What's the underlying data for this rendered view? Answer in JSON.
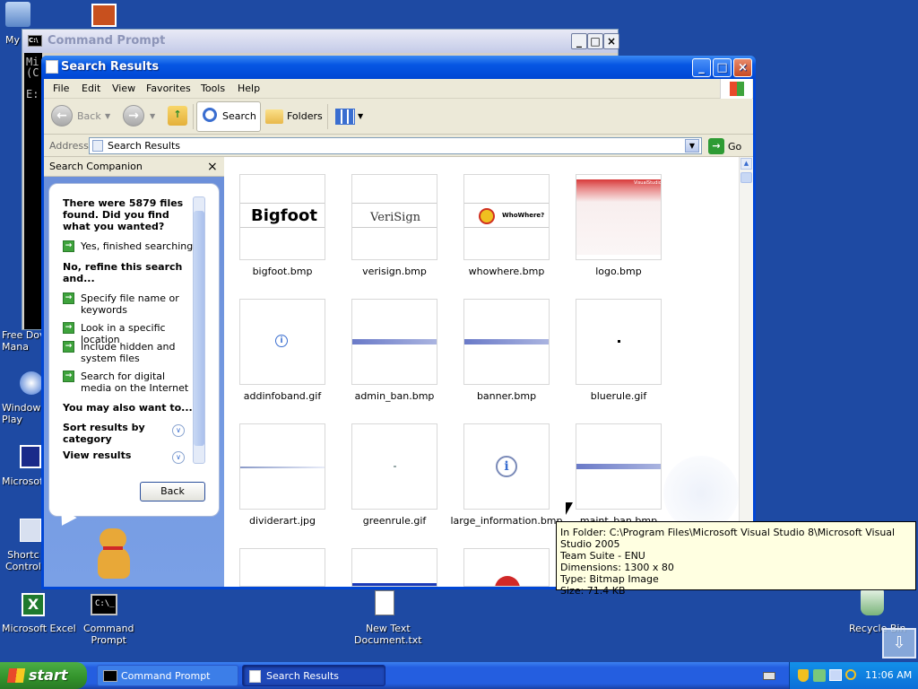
{
  "desktop": {
    "icons": [
      {
        "label": "My"
      },
      {
        "label": "Free Dov\nMana"
      },
      {
        "label": "Windows\nPlay"
      },
      {
        "label": "Microsoft"
      },
      {
        "label": "Shortc\nControl"
      },
      {
        "label": "Microsoft Excel"
      },
      {
        "label": "Command\nPrompt"
      },
      {
        "label": "New Text\nDocument.txt"
      },
      {
        "label": "Recycle Bin"
      }
    ]
  },
  "cmd": {
    "title": "Command Prompt",
    "lines": "Mi\n(C\n\nE:"
  },
  "win": {
    "title": "Search Results",
    "menu": [
      "File",
      "Edit",
      "View",
      "Favorites",
      "Tools",
      "Help"
    ],
    "toolbar": {
      "back": "Back",
      "search": "Search",
      "folders": "Folders"
    },
    "address_label": "Address",
    "address_value": "Search Results",
    "go": "Go"
  },
  "companion": {
    "header": "Search Companion",
    "found": "There were 5879 files found. Did you find what you wanted?",
    "yes": "Yes, finished searching",
    "refine": "No, refine this search and...",
    "options": [
      "Specify file name or keywords",
      "Look in a specific location",
      "Include hidden and system files",
      "Search for digital media on the Internet"
    ],
    "maywant": "You may also want to...",
    "sort": "Sort results by category",
    "view": "View results",
    "back": "Back"
  },
  "files": [
    {
      "name": "bigfoot.bmp",
      "thumb": "Bigfoot"
    },
    {
      "name": "verisign.bmp",
      "thumb": "VeriSign"
    },
    {
      "name": "whowhere.bmp",
      "thumb": "WhoWhere?"
    },
    {
      "name": "logo.bmp",
      "thumb": "VisualStudio"
    },
    {
      "name": "addinfoband.gif",
      "thumb": ""
    },
    {
      "name": "admin_ban.bmp",
      "thumb": ""
    },
    {
      "name": "banner.bmp",
      "thumb": ""
    },
    {
      "name": "bluerule.gif",
      "thumb": ""
    },
    {
      "name": "dividerart.jpg",
      "thumb": ""
    },
    {
      "name": "greenrule.gif",
      "thumb": ""
    },
    {
      "name": "large_information.bmp",
      "thumb": ""
    },
    {
      "name": "maint_ban.bmp",
      "thumb": ""
    }
  ],
  "tooltip": {
    "line1": "In Folder: C:\\Program Files\\Microsoft Visual Studio 8\\Microsoft Visual Studio 2005",
    "line2": "Team Suite - ENU",
    "line3": "Dimensions: 1300 x 80",
    "line4": "Type: Bitmap Image",
    "line5": "Size: 71.4 KB"
  },
  "taskbar": {
    "start": "start",
    "tasks": [
      "Command Prompt",
      "Search Results"
    ],
    "clock": "11:06 AM"
  },
  "colors": {
    "desktop": "#1e4aa3",
    "titlebar": "#0656e3",
    "start": "#32922b"
  }
}
